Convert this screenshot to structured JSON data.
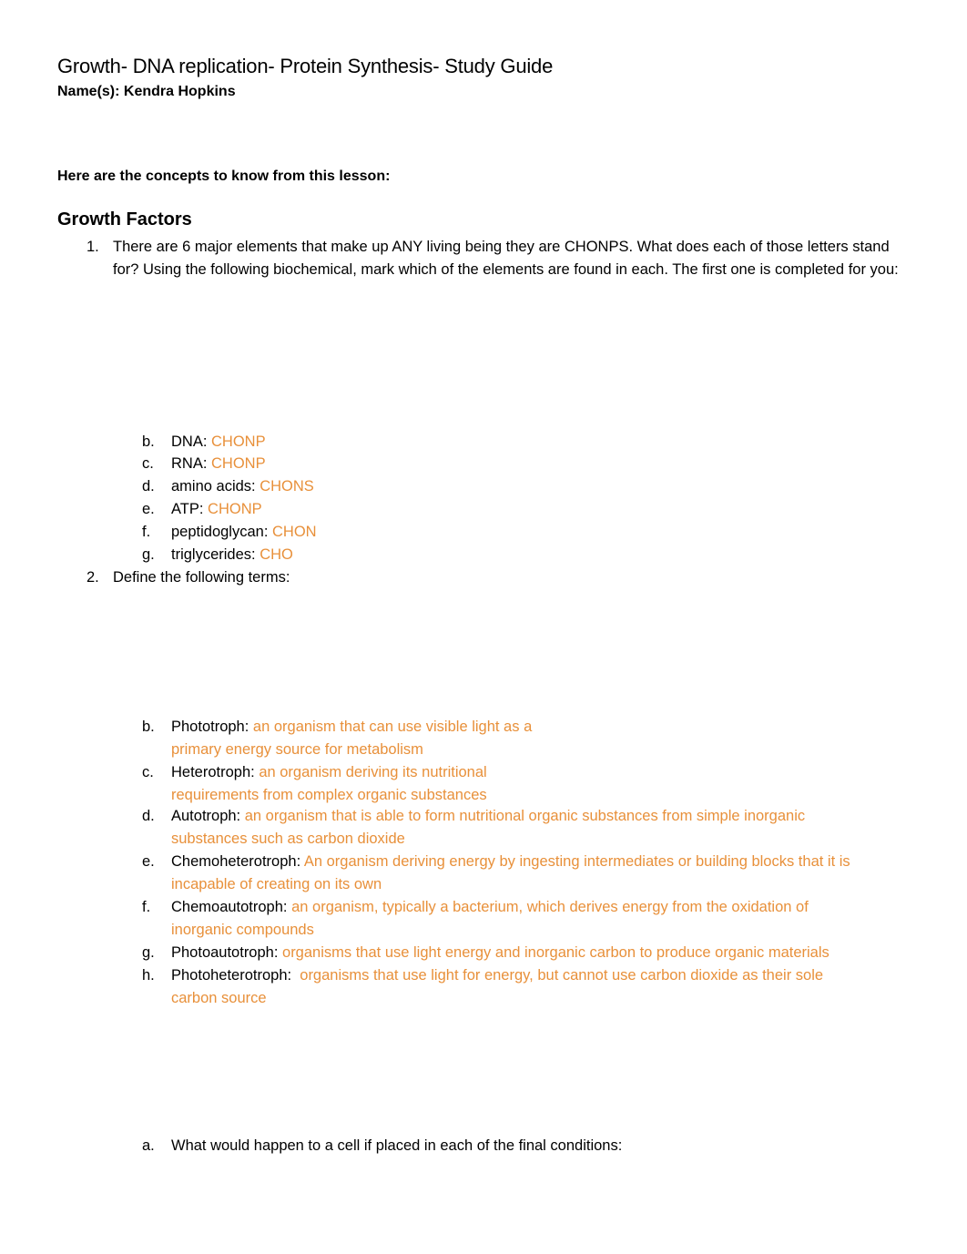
{
  "document": {
    "title": "Growth- DNA replication- Protein Synthesis- Study Guide",
    "name_line": "Name(s): Kendra Hopkins",
    "intro": "Here are the concepts to know from this lesson:",
    "section_title": "Growth Factors",
    "answer_color": "#E8903A"
  },
  "q1": {
    "number": "1.",
    "text": "There are 6 major elements that make up ANY living being they are CHONPS. What does each of those letters stand for? Using the following biochemical, mark which of the elements are found in each. The first one is completed for you:",
    "items": [
      {
        "letter": "b.",
        "term": "DNA: ",
        "answer": "CHONP"
      },
      {
        "letter": "c.",
        "term": "RNA: ",
        "answer": "CHONP"
      },
      {
        "letter": "d.",
        "term": "amino acids: ",
        "answer": "CHONS"
      },
      {
        "letter": "e.",
        "term": "ATP: ",
        "answer": "CHONP"
      },
      {
        "letter": "f.",
        "term": "peptidoglycan: ",
        "answer": "CHON"
      },
      {
        "letter": "g.",
        "term": "triglycerides: ",
        "answer": "CHO"
      }
    ]
  },
  "q2": {
    "number": "2.",
    "text": "Define the following terms:",
    "items": [
      {
        "letter": "b.",
        "term": "Phototroph: ",
        "answer_line1": "an organism that can use visible light as a",
        "answer_line2": "primary energy source for metabolism"
      },
      {
        "letter": "c.",
        "term": "Heterotroph: ",
        "answer_line1": "an organism deriving its nutritional",
        "answer_line2": "requirements from complex organic substances"
      },
      {
        "letter": "d.",
        "term": "Autotroph: ",
        "answer_line1": "an organism that is able to form nutritional organic substances from simple inorganic",
        "answer_line2": "substances such as carbon dioxide"
      },
      {
        "letter": "e.",
        "term": "Chemoheterotroph: ",
        "answer_line1": "An organism deriving energy by ingesting intermediates or building blocks that it is",
        "answer_line2": "incapable of creating on its own"
      },
      {
        "letter": "f.",
        "term": "Chemoautotroph: ",
        "answer_line1": "an organism, typically a bacterium, which derives energy from the oxidation of",
        "answer_line2": "inorganic compounds"
      },
      {
        "letter": "g.",
        "term": "Photoautotroph: ",
        "answer_line1": "organisms that use light energy and inorganic carbon to produce organic materials",
        "answer_line2": ""
      },
      {
        "letter": "h.",
        "term": "Photoheterotroph:  ",
        "answer_line1": "organisms that use light for energy, but cannot use carbon dioxide as their sole",
        "answer_line2": "carbon source"
      }
    ]
  },
  "q3": {
    "letter": "a.",
    "text": "What would happen to a cell if placed in each of the final conditions:"
  }
}
